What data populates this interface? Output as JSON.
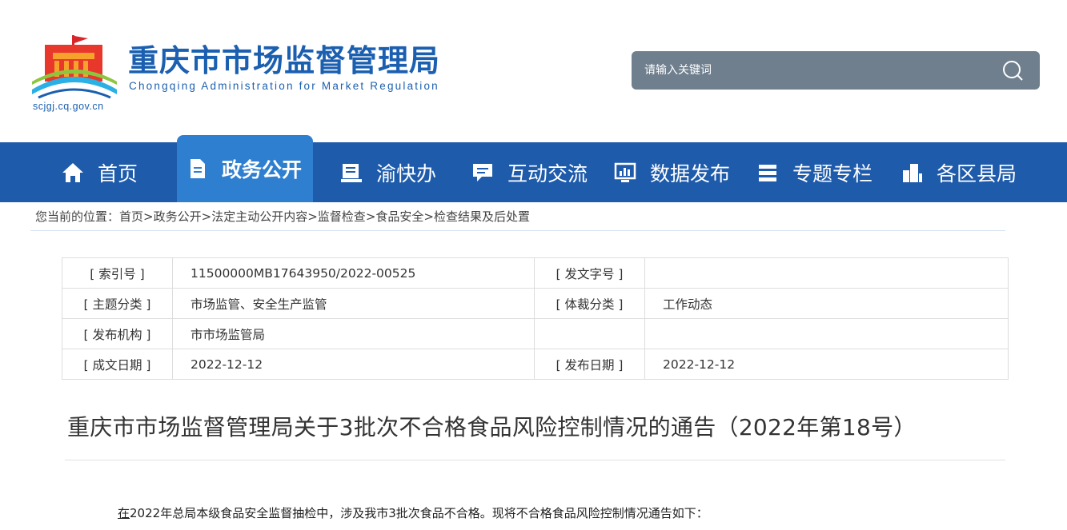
{
  "header": {
    "site_name": "重庆市市场监督管理局",
    "site_name_en": "Chongqing  Administration for Market Regulation",
    "domain": "scjgj.cq.gov.cn",
    "search_placeholder": "请输入关键词",
    "search_icon": "search-icon"
  },
  "nav": {
    "items": [
      {
        "label": "首页",
        "icon": "home-icon"
      },
      {
        "label": "政务公开",
        "icon": "document-icon",
        "active": true
      },
      {
        "label": "渝快办",
        "icon": "book-icon"
      },
      {
        "label": "互动交流",
        "icon": "chat-icon"
      },
      {
        "label": "数据发布",
        "icon": "chart-icon"
      },
      {
        "label": "专题专栏",
        "icon": "list-icon"
      },
      {
        "label": "各区县局",
        "icon": "buildings-icon"
      }
    ]
  },
  "breadcrumb": {
    "prefix": "您当前的位置：",
    "items": [
      "首页",
      "政务公开",
      "法定主动公开内容",
      "监督检查",
      "食品安全",
      "检查结果及后处置"
    ],
    "separator": ">"
  },
  "info_table": {
    "rows": [
      {
        "label1": "[ 索引号 ]",
        "value1": "11500000MB17643950/2022-00525",
        "label2": "[ 发文字号 ]",
        "value2": ""
      },
      {
        "label1": "[ 主题分类 ]",
        "value1": "市场监管、安全生产监管",
        "label2": "[ 体裁分类 ]",
        "value2": "工作动态"
      },
      {
        "label1": "[ 发布机构 ]",
        "value1": "市市场监管局",
        "label2": "",
        "value2": ""
      },
      {
        "label1": "[ 成文日期 ]",
        "value1": "2022-12-12",
        "label2": "[ 发布日期 ]",
        "value2": "2022-12-12"
      }
    ]
  },
  "document": {
    "title": "重庆市市场监督管理局关于3批次不合格食品风险控制情况的通告（2022年第18号）",
    "body_first_char": "在",
    "body_rest": "2022年总局本级食品安全监督抽检中，涉及我市3批次食品不合格。现将不合格食品风险控制情况通告如下："
  },
  "colors": {
    "nav_bg": "#1e5bab",
    "nav_active_bg": "#2f7fd0",
    "brand_blue": "#1b5fb0",
    "search_bg": "#6f7f8e"
  }
}
